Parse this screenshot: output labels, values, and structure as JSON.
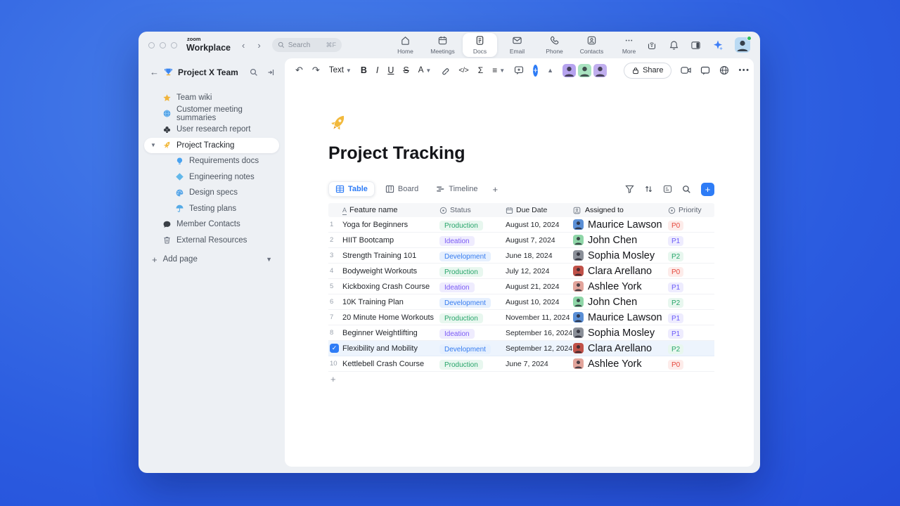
{
  "topbar": {
    "logo_top": "zoom",
    "logo_bottom": "Workplace",
    "search": {
      "placeholder": "Search",
      "shortcut": "⌘F"
    },
    "nav": [
      {
        "icon": "home-icon",
        "label": "Home",
        "active": false
      },
      {
        "icon": "meetings-icon",
        "label": "Meetings",
        "active": false
      },
      {
        "icon": "docs-icon",
        "label": "Docs",
        "active": true
      },
      {
        "icon": "email-icon",
        "label": "Email",
        "active": false
      },
      {
        "icon": "phone-icon",
        "label": "Phone",
        "active": false
      },
      {
        "icon": "contacts-icon",
        "label": "Contacts",
        "active": false
      },
      {
        "icon": "more-icon",
        "label": "More",
        "active": false
      }
    ]
  },
  "sidebar": {
    "workspace_title": "Project X Team",
    "items": [
      {
        "icon": "star-icon",
        "label": "Team wiki",
        "level": 1,
        "selected": false
      },
      {
        "icon": "globe-icon",
        "label": "Customer meeting summaries",
        "level": 1,
        "selected": false
      },
      {
        "icon": "club-icon",
        "label": "User research report",
        "level": 1,
        "selected": false
      },
      {
        "icon": "rocket-icon",
        "label": "Project Tracking",
        "level": 1,
        "selected": true,
        "expanded": true
      },
      {
        "icon": "bulb-icon",
        "label": "Requirements docs",
        "level": 2,
        "selected": false
      },
      {
        "icon": "diamond-icon",
        "label": "Engineering notes",
        "level": 2,
        "selected": false
      },
      {
        "icon": "palette-icon",
        "label": "Design specs",
        "level": 2,
        "selected": false
      },
      {
        "icon": "umbrella-icon",
        "label": "Testing plans",
        "level": 2,
        "selected": false
      },
      {
        "icon": "chat-icon",
        "label": "Member Contacts",
        "level": 1,
        "selected": false
      },
      {
        "icon": "trash-icon",
        "label": "External Resources",
        "level": 1,
        "selected": false
      }
    ],
    "add_page": "Add page"
  },
  "toolbar": {
    "text_style": "Text",
    "bold": "B",
    "italic": "I",
    "underline": "U",
    "strikethrough": "S",
    "font_color": "A",
    "code": "</>",
    "formula": "Σ",
    "share_label": "Share",
    "collaborators": [
      {
        "name": "collaborator-1",
        "color": "#b6a3ef"
      },
      {
        "name": "collaborator-2",
        "color": "#a9e3c0"
      },
      {
        "name": "collaborator-3",
        "color": "#c0aeee"
      }
    ]
  },
  "doc": {
    "emoji": "rocket",
    "title": "Project Tracking"
  },
  "views": {
    "tabs": [
      {
        "icon": "table-view-icon",
        "label": "Table",
        "active": true
      },
      {
        "icon": "board-view-icon",
        "label": "Board",
        "active": false
      },
      {
        "icon": "timeline-view-icon",
        "label": "Timeline",
        "active": false
      }
    ]
  },
  "table": {
    "columns": [
      {
        "icon": "text-type-icon",
        "label": "Feature name"
      },
      {
        "icon": "select-type-icon",
        "label": "Status"
      },
      {
        "icon": "date-type-icon",
        "label": "Due Date"
      },
      {
        "icon": "person-type-icon",
        "label": "Assigned to"
      },
      {
        "icon": "select-type-icon",
        "label": "Priority"
      }
    ],
    "rows": [
      {
        "num": "1",
        "feature": "Yoga for Beginners",
        "status": "Production",
        "due": "August 10, 2024",
        "assignee": "Maurice Lawson",
        "priority": "P0",
        "selected": false
      },
      {
        "num": "2",
        "feature": "HIIT Bootcamp",
        "status": "Ideation",
        "due": "August 7, 2024",
        "assignee": "John Chen",
        "priority": "P1",
        "selected": false
      },
      {
        "num": "3",
        "feature": "Strength Training 101",
        "status": "Development",
        "due": "June 18, 2024",
        "assignee": "Sophia Mosley",
        "priority": "P2",
        "selected": false
      },
      {
        "num": "4",
        "feature": "Bodyweight Workouts",
        "status": "Production",
        "due": "July 12, 2024",
        "assignee": "Clara Arellano",
        "priority": "P0",
        "selected": false
      },
      {
        "num": "5",
        "feature": "Kickboxing Crash Course",
        "status": "Ideation",
        "due": "August 21, 2024",
        "assignee": "Ashlee York",
        "priority": "P1",
        "selected": false
      },
      {
        "num": "6",
        "feature": "10K Training Plan",
        "status": "Development",
        "due": "August 10, 2024",
        "assignee": "John Chen",
        "priority": "P2",
        "selected": false
      },
      {
        "num": "7",
        "feature": "20 Minute Home Workouts",
        "status": "Production",
        "due": "November 11, 2024",
        "assignee": "Maurice Lawson",
        "priority": "P1",
        "selected": false
      },
      {
        "num": "8",
        "feature": "Beginner Weightlifting",
        "status": "Ideation",
        "due": "September 16, 2024",
        "assignee": "Sophia Mosley",
        "priority": "P1",
        "selected": false
      },
      {
        "num": "9",
        "feature": "Flexibility and Mobility",
        "status": "Development",
        "due": "September 12, 2024",
        "assignee": "Clara Arellano",
        "priority": "P2",
        "selected": true
      },
      {
        "num": "10",
        "feature": "Kettlebell Crash Course",
        "status": "Production",
        "due": "June 7, 2024",
        "assignee": "Ashlee York",
        "priority": "P0",
        "selected": false
      }
    ]
  },
  "colors": {
    "accent": "#2e7cf6",
    "status": {
      "Production": {
        "text": "#27a56a",
        "bg": "#e8f7ef"
      },
      "Ideation": {
        "text": "#7b5bf5",
        "bg": "#efecfe"
      },
      "Development": {
        "text": "#377df0",
        "bg": "#e6f0fe"
      }
    },
    "priority": {
      "P0": {
        "text": "#e5483d",
        "bg": "#fdecea"
      },
      "P1": {
        "text": "#6a5af9",
        "bg": "#eeecfe"
      },
      "P2": {
        "text": "#27a56a",
        "bg": "#e8f7ef"
      }
    },
    "avatars": {
      "Maurice Lawson": "#5a8fd6",
      "John Chen": "#8fd6a8",
      "Sophia Mosley": "#8a8f98",
      "Clara Arellano": "#c05148",
      "Ashlee York": "#e2a49b"
    }
  }
}
